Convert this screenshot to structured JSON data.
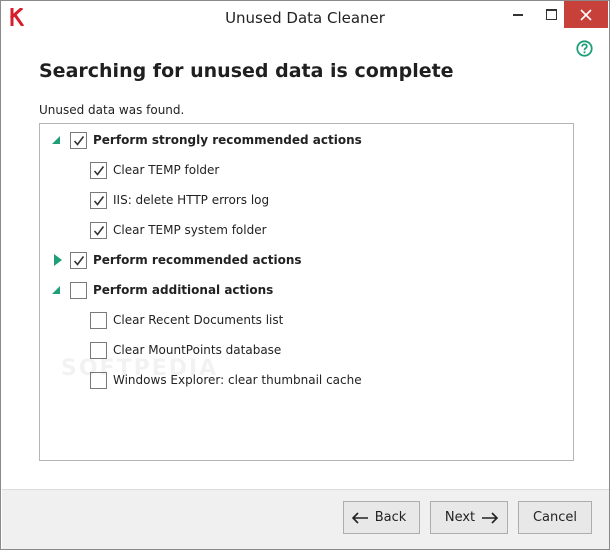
{
  "window": {
    "title": "Unused Data Cleaner"
  },
  "page": {
    "heading": "Searching for unused data is complete",
    "subtext": "Unused data was found."
  },
  "tree": {
    "groups": [
      {
        "label": "Perform strongly recommended actions",
        "checked": true,
        "expanded": true,
        "items": [
          {
            "label": "Clear TEMP folder",
            "checked": true
          },
          {
            "label": "IIS: delete HTTP errors log",
            "checked": true
          },
          {
            "label": "Clear TEMP system folder",
            "checked": true
          }
        ]
      },
      {
        "label": "Perform recommended actions",
        "checked": true,
        "expanded": false,
        "items": []
      },
      {
        "label": "Perform additional actions",
        "checked": false,
        "expanded": true,
        "items": [
          {
            "label": "Clear Recent Documents list",
            "checked": false
          },
          {
            "label": "Clear MountPoints database",
            "checked": false
          },
          {
            "label": "Windows Explorer: clear thumbnail cache",
            "checked": false
          }
        ]
      }
    ]
  },
  "buttons": {
    "back": "Back",
    "next": "Next",
    "cancel": "Cancel"
  },
  "watermark": "SOFTPEDIA",
  "colors": {
    "accent": "#1f9e78",
    "close": "#c7403a",
    "logo": "#d81e2c"
  }
}
